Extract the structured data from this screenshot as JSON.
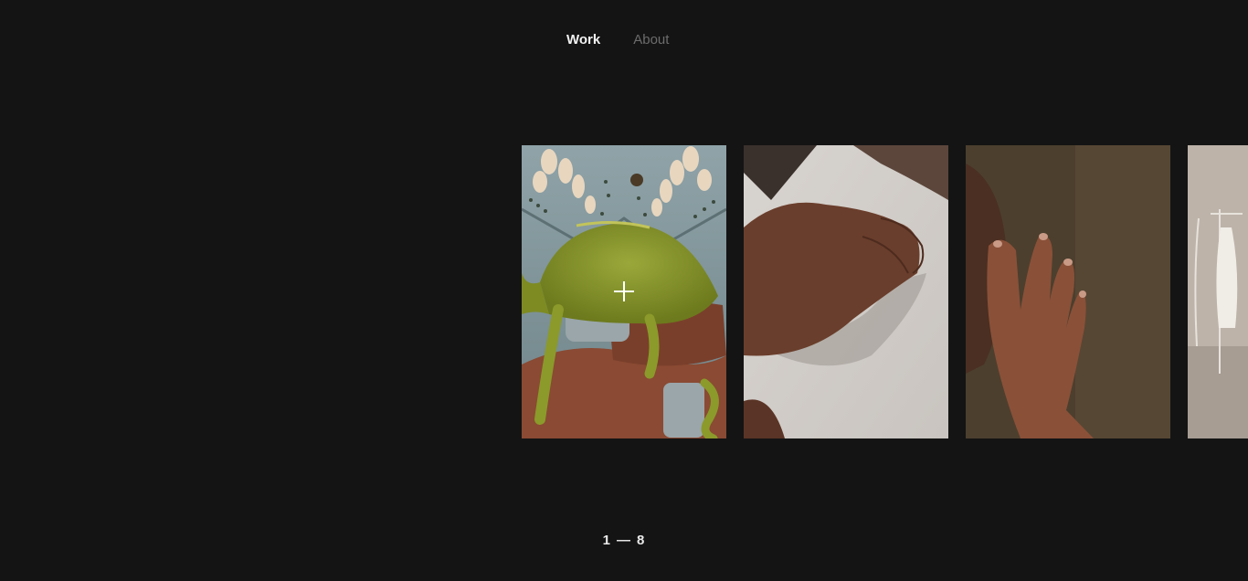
{
  "nav": {
    "items": [
      {
        "label": "Work",
        "active": true
      },
      {
        "label": "About",
        "active": false
      }
    ]
  },
  "gallery": {
    "slides": [
      {
        "name": "chameleon-on-hands-photo"
      },
      {
        "name": "hand-on-white-surface-photo"
      },
      {
        "name": "hand-on-face-photo"
      },
      {
        "name": "clothing-rack-photo"
      }
    ]
  },
  "counter": {
    "current": "1",
    "separator": "—",
    "total": "8"
  },
  "colors": {
    "background": "#141414",
    "nav_active": "#f2f2f2",
    "nav_inactive": "#6c6c6c"
  },
  "cursor": {
    "icon": "crosshair-icon"
  }
}
